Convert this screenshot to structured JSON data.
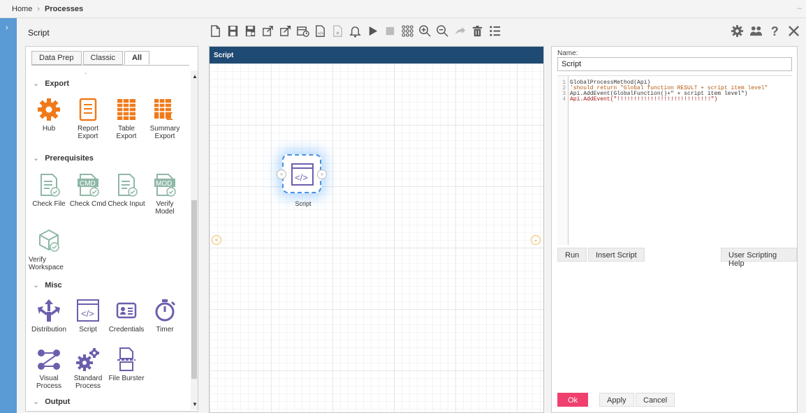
{
  "breadcrumb": {
    "home": "Home",
    "separator": "›",
    "current": "Processes"
  },
  "document_title": "Script",
  "toolbar_icons": [
    "new-document-icon",
    "save-icon",
    "save-as-icon",
    "resize-icon",
    "export-icon",
    "schedule-icon",
    "code-icon",
    "locked-document-icon",
    "bell-icon",
    "play-icon",
    "stop-icon",
    "grid-icon",
    "zoom-in-icon",
    "zoom-out-icon",
    "forward-icon",
    "delete-icon",
    "list-icon"
  ],
  "right_icons": [
    "settings-icon",
    "users-icon",
    "help-icon",
    "close-icon"
  ],
  "palette": {
    "tabs": [
      "Data Prep",
      "Classic",
      "All"
    ],
    "active_tab": "All",
    "dot": ".",
    "sections": {
      "export": {
        "title": "Export",
        "items": [
          "Hub",
          "Report Export",
          "Table Export",
          "Summary Export"
        ]
      },
      "prerequisites": {
        "title": "Prerequisites",
        "items": [
          "Check File",
          "Check Cmd",
          "Check Input",
          "Verify Model",
          "Verify Workspace"
        ]
      },
      "misc": {
        "title": "Misc",
        "items": [
          "Distribution",
          "Script",
          "Credentials",
          "Timer",
          "Visual Process",
          "Standard Process",
          "File Burster"
        ]
      },
      "output": {
        "title": "Output"
      }
    },
    "labels": {
      "hub": "Hub",
      "report_export_1": "Report",
      "report_export_2": "Export",
      "table_export_1": "Table",
      "table_export_2": "Export",
      "summary_export_1": "Summary",
      "summary_export_2": "Export",
      "check_file": "Check File",
      "check_cmd": "Check Cmd",
      "check_input": "Check Input",
      "verify_model_1": "Verify",
      "verify_model_2": "Model",
      "verify_ws_1": "Verify",
      "verify_ws_2": "Workspace",
      "distribution": "Distribution",
      "script": "Script",
      "credentials": "Credentials",
      "timer": "Timer",
      "visual_process_1": "Visual",
      "visual_process_2": "Process",
      "standard_process_1": "Standard",
      "standard_process_2": "Process",
      "file_burster": "File Burster",
      "cmd_badge": "CMD",
      "mod_badge": "MOD"
    }
  },
  "canvas": {
    "header": "Script",
    "node_label": "Script"
  },
  "properties": {
    "name_label": "Name:",
    "name_value": "Script",
    "code_lines": [
      {
        "n": "1",
        "text": "GlobalProcessMethod(Api)"
      },
      {
        "n": "2",
        "text": "'should return  \"Global function RESULT + script item level\""
      },
      {
        "n": "3",
        "text": "Api.AddEvent(GlobalFunction()+\" + script item level\")"
      },
      {
        "n": "4",
        "text": "Api.AddEvent(\"!!!!!!!!!!!!!!!!!!!!!!!!!!!!\")"
      }
    ],
    "buttons": {
      "run": "Run",
      "insert_script": "Insert Script",
      "help": "User Scripting Help",
      "ok": "Ok",
      "apply": "Apply",
      "cancel": "Cancel"
    }
  },
  "colors": {
    "accent": "#1e4a73",
    "ok_button": "#f0406e",
    "icon_purple": "#6b5fad",
    "icon_orange": "#f07a1a",
    "icon_sage": "#8fb8a6"
  }
}
